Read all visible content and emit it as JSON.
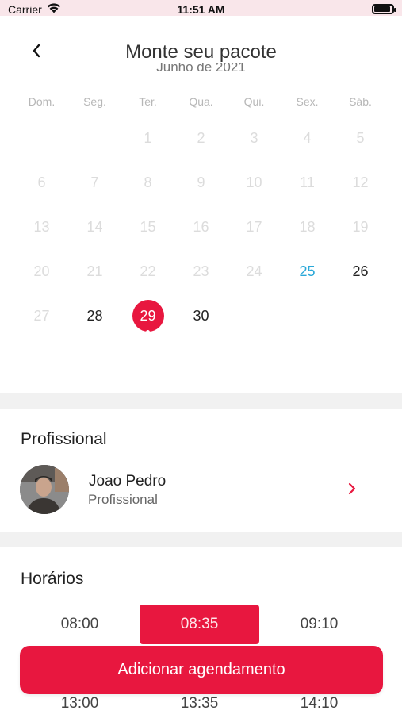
{
  "status_bar": {
    "carrier": "Carrier",
    "time": "11:51 AM",
    "battery_level": 0.9
  },
  "header": {
    "title": "Monte seu pacote",
    "month": "Junho de 2021"
  },
  "calendar": {
    "weekdays": [
      "Dom.",
      "Seg.",
      "Ter.",
      "Qua.",
      "Qui.",
      "Sex.",
      "Sáb."
    ],
    "weeks": [
      [
        {
          "d": ""
        },
        {
          "d": ""
        },
        {
          "d": "1",
          "s": "disabled"
        },
        {
          "d": "2",
          "s": "disabled"
        },
        {
          "d": "3",
          "s": "disabled"
        },
        {
          "d": "4",
          "s": "disabled"
        },
        {
          "d": "5",
          "s": "disabled"
        }
      ],
      [
        {
          "d": "6",
          "s": "disabled"
        },
        {
          "d": "7",
          "s": "disabled"
        },
        {
          "d": "8",
          "s": "disabled"
        },
        {
          "d": "9",
          "s": "disabled"
        },
        {
          "d": "10",
          "s": "disabled"
        },
        {
          "d": "11",
          "s": "disabled"
        },
        {
          "d": "12",
          "s": "disabled"
        }
      ],
      [
        {
          "d": "13",
          "s": "disabled"
        },
        {
          "d": "14",
          "s": "disabled"
        },
        {
          "d": "15",
          "s": "disabled"
        },
        {
          "d": "16",
          "s": "disabled"
        },
        {
          "d": "17",
          "s": "disabled"
        },
        {
          "d": "18",
          "s": "disabled"
        },
        {
          "d": "19",
          "s": "disabled"
        }
      ],
      [
        {
          "d": "20",
          "s": "disabled"
        },
        {
          "d": "21",
          "s": "disabled"
        },
        {
          "d": "22",
          "s": "disabled"
        },
        {
          "d": "23",
          "s": "disabled"
        },
        {
          "d": "24",
          "s": "disabled"
        },
        {
          "d": "25",
          "s": "today"
        },
        {
          "d": "26",
          "s": "active"
        }
      ],
      [
        {
          "d": "27",
          "s": "disabled"
        },
        {
          "d": "28",
          "s": "active"
        },
        {
          "d": "29",
          "s": "selected"
        },
        {
          "d": "30",
          "s": "active"
        },
        {
          "d": ""
        },
        {
          "d": ""
        },
        {
          "d": ""
        }
      ]
    ]
  },
  "professional": {
    "section_title": "Profissional",
    "name": "Joao Pedro",
    "role": "Profissional"
  },
  "schedule": {
    "section_title": "Horários",
    "times": [
      {
        "label": "08:00",
        "selected": false
      },
      {
        "label": "08:35",
        "selected": true
      },
      {
        "label": "09:10",
        "selected": false
      },
      {
        "label": "13:00",
        "selected": false
      },
      {
        "label": "13:35",
        "selected": false
      },
      {
        "label": "14:10",
        "selected": false
      }
    ]
  },
  "actions": {
    "add_label": "Adicionar agendamento"
  },
  "colors": {
    "accent": "#e8173f",
    "today": "#2aa8d8",
    "disabled": "#dcdcdc",
    "divider": "#f1f1f1"
  }
}
